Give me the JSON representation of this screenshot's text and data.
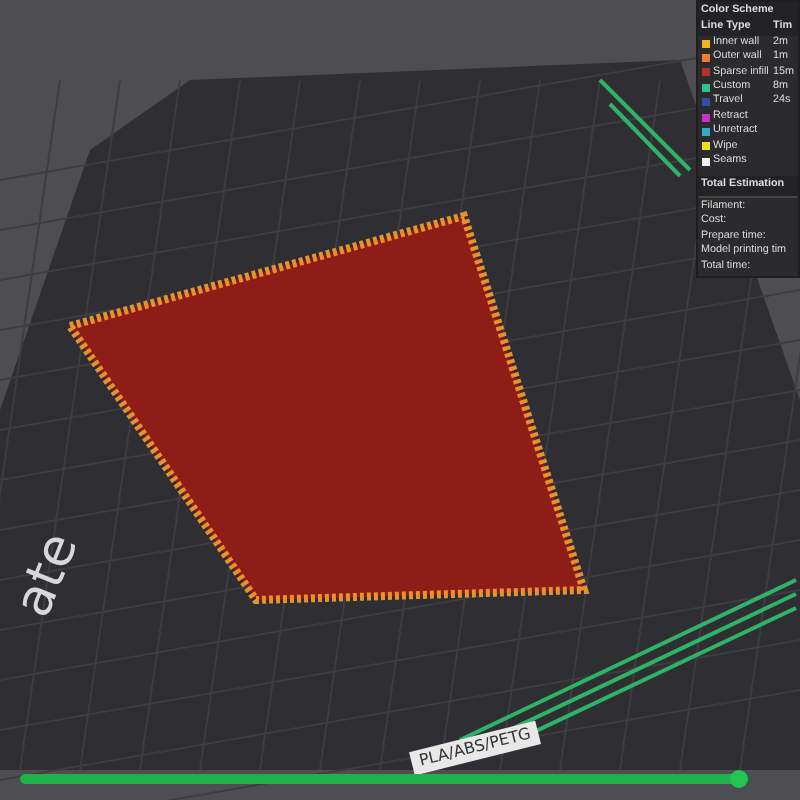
{
  "legend": {
    "title": "Color Scheme",
    "columns": [
      "Line Type",
      "Tim"
    ],
    "items": [
      {
        "label": "Inner wall",
        "time": "2m",
        "color": "#f2b51c"
      },
      {
        "label": "Outer wall",
        "time": "1m",
        "color": "#f07c30"
      },
      {
        "label": "Sparse infill",
        "time": "15m",
        "color": "#b5302a"
      },
      {
        "label": "Custom",
        "time": "8m",
        "color": "#2ec28f"
      },
      {
        "label": "Travel",
        "time": "24s",
        "color": "#2f4fb0"
      },
      {
        "label": "Retract",
        "color": "#c932c9"
      },
      {
        "label": "Unretract",
        "color": "#35a9c9"
      },
      {
        "label": "Wipe",
        "color": "#f0e020"
      },
      {
        "label": "Seams",
        "color": "#f0f0f0"
      }
    ],
    "total_title": "Total Estimation",
    "total_rows": [
      "Filament:",
      "Cost:",
      "Prepare time:",
      "Model printing tim",
      "Total time:"
    ]
  },
  "plate": {
    "name": "ate",
    "material": "PLA/ABS/PETG"
  },
  "layer_slider": {
    "level": 0.985
  }
}
